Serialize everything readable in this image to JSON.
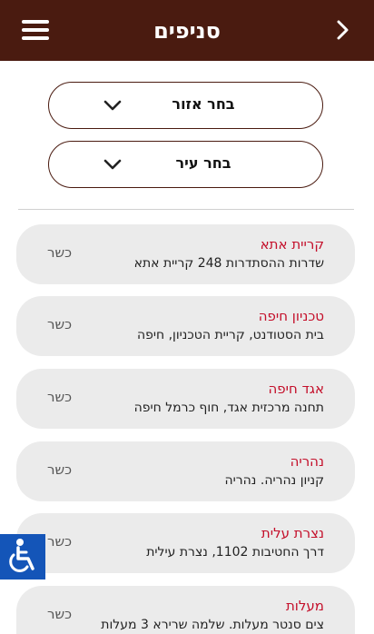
{
  "header": {
    "title": "סניפים"
  },
  "filters": {
    "region_label": "בחר אזור",
    "city_label": "בחר עיר"
  },
  "branches": [
    {
      "name": "קריית אתא",
      "address": "שדרות ההסתדרות 248 קריית אתא",
      "kosher": "כשר"
    },
    {
      "name": "טכניון חיפה",
      "address": "בית הסטודנט, קריית הטכניון, חיפה",
      "kosher": "כשר"
    },
    {
      "name": "אגד חיפה",
      "address": "תחנה מרכזית אגד, חוף כרמל חיפה",
      "kosher": "כשר"
    },
    {
      "name": "נהריה",
      "address": "קניון נהריה. נהריה",
      "kosher": "כשר"
    },
    {
      "name": "נצרת עלית",
      "address": "דרך החטיבות 1102, נצרת עילית",
      "kosher": "כשר"
    },
    {
      "name": "מעלות",
      "address": "צים סנטר מעלות. שלמה שרירא 3 מעלות",
      "kosher": "כשר"
    }
  ],
  "colors": {
    "header_bg": "#4a1b10",
    "branch_name": "#c40f2a",
    "accessibility_bg": "#1455b8"
  },
  "icons": {
    "menu": "hamburger-menu-icon",
    "back": "chevron-right-icon",
    "dropdown": "chevron-down-icon",
    "accessibility": "wheelchair-icon"
  }
}
